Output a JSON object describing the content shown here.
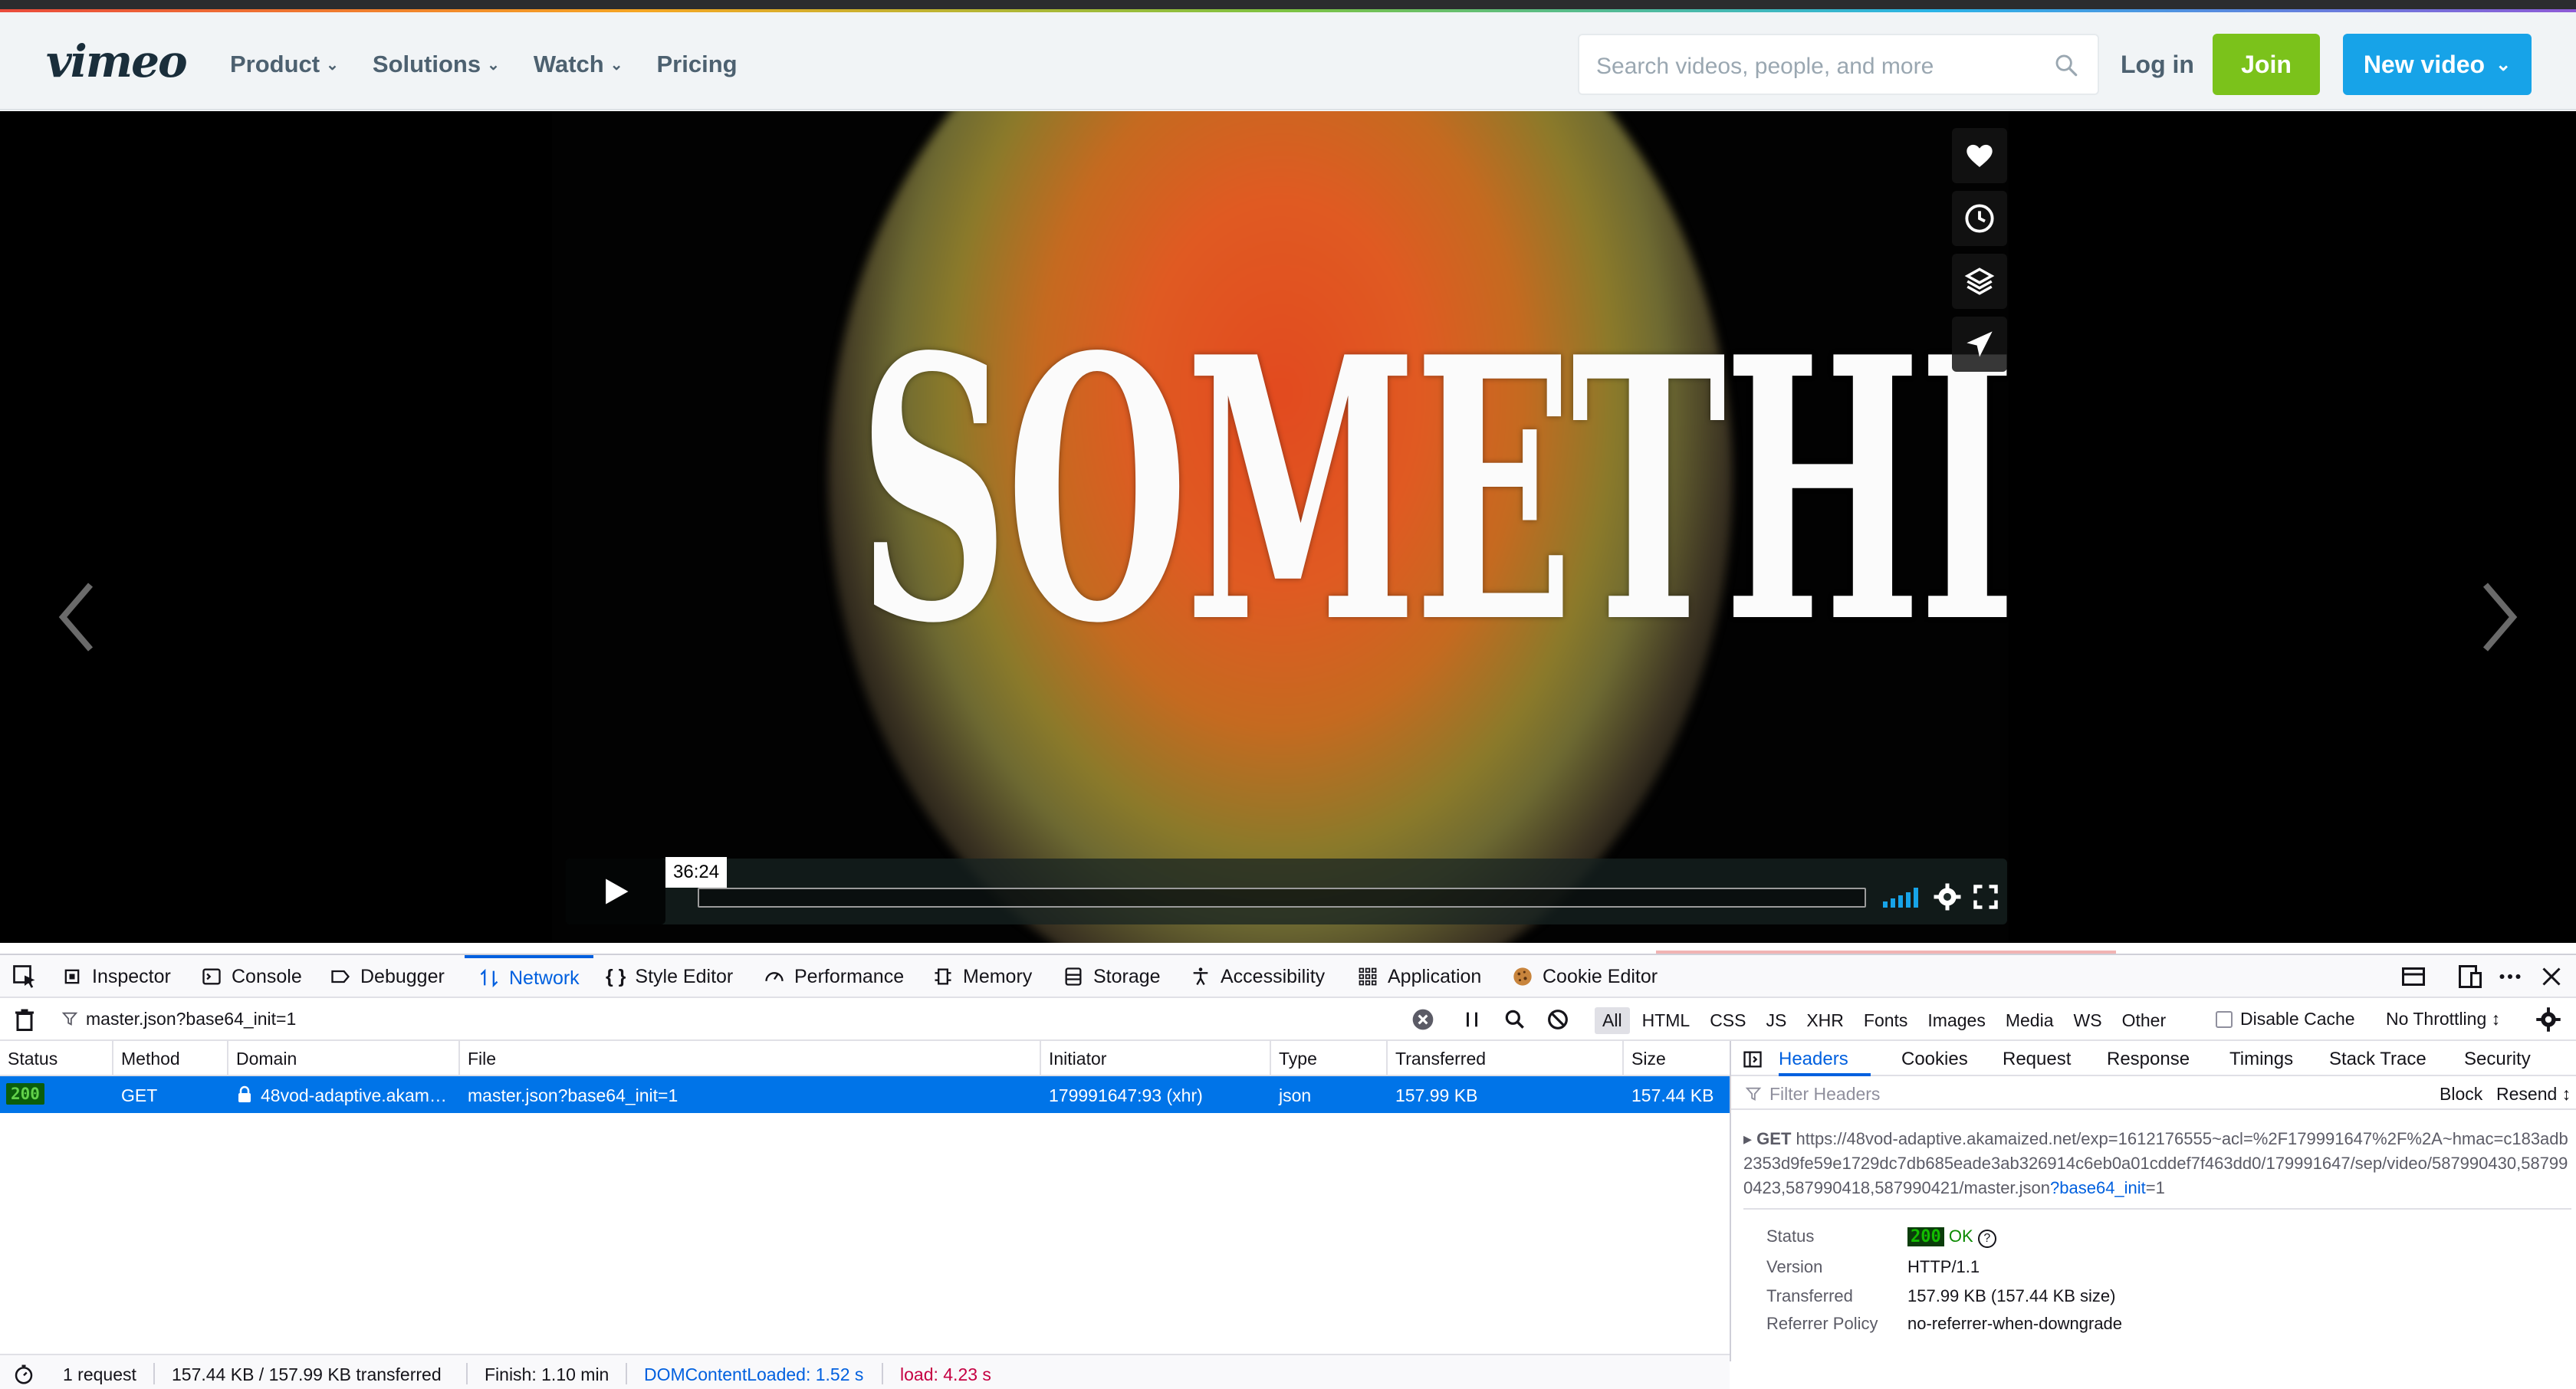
{
  "header": {
    "logo": "vimeo",
    "nav": [
      "Product",
      "Solutions",
      "Watch",
      "Pricing"
    ],
    "search_placeholder": "Search videos, people, and more",
    "login": "Log in",
    "join": "Join",
    "new_video": "New video"
  },
  "video": {
    "title_word": "SOMETHING",
    "time": "36:24",
    "progress": 0.0
  },
  "devtools": {
    "tabs": [
      "Inspector",
      "Console",
      "Debugger",
      "Network",
      "Style Editor",
      "Performance",
      "Memory",
      "Storage",
      "Accessibility",
      "Application",
      "Cookie Editor"
    ],
    "active_tab": "Network",
    "filter_url": "master.json?base64_init=1",
    "filter_types": [
      "All",
      "HTML",
      "CSS",
      "JS",
      "XHR",
      "Fonts",
      "Images",
      "Media",
      "WS",
      "Other"
    ],
    "disable_cache": "Disable Cache",
    "throttling": "No Throttling ↕",
    "columns": [
      "Status",
      "Method",
      "Domain",
      "File",
      "Initiator",
      "Type",
      "Transferred",
      "Size"
    ],
    "request": {
      "status": "200",
      "method": "GET",
      "domain": "48vod-adaptive.akam…",
      "file": "master.json?base64_init=1",
      "initiator": "179991647:93 (xhr)",
      "type": "json",
      "transferred": "157.99 KB",
      "size": "157.44 KB"
    },
    "panel_tabs": [
      "Headers",
      "Cookies",
      "Request",
      "Response",
      "Timings",
      "Stack Trace",
      "Security"
    ],
    "filter_headers_placeholder": "Filter Headers",
    "block": "Block",
    "resend": "Resend ↕",
    "get_label": "GET",
    "url_main": "https://48vod-adaptive.akamaized.net/exp=1612176555~acl=%2F179991647%2F%2A~hmac=c183adb2353d9fe59e1729dc7db685eade3ab326914c6eb0a01cddef7f463dd0/179991647/sep/video/587990430,587990423,587990418,587990421/master.json",
    "url_query_key": "?base64_init",
    "url_query_val": "=1",
    "details": {
      "status_label": "Status",
      "status_code": "200",
      "status_text": "OK",
      "version_label": "Version",
      "version": "HTTP/1.1",
      "transferred_label": "Transferred",
      "transferred": "157.99 KB (157.44 KB size)",
      "referrer_label": "Referrer Policy",
      "referrer": "no-referrer-when-downgrade"
    },
    "statusbar": {
      "requests": "1 request",
      "size": "157.44 KB / 157.99 KB transferred",
      "finish": "Finish: 1.10 min",
      "dom": "DOMContentLoaded: 1.52 s",
      "load": "load: 4.23 s"
    }
  },
  "colors": {
    "accent_blue": "#0060df",
    "selected_row": "#0074e8",
    "join_green": "#7bc21b",
    "vimeo_blue": "#17a3e8"
  }
}
